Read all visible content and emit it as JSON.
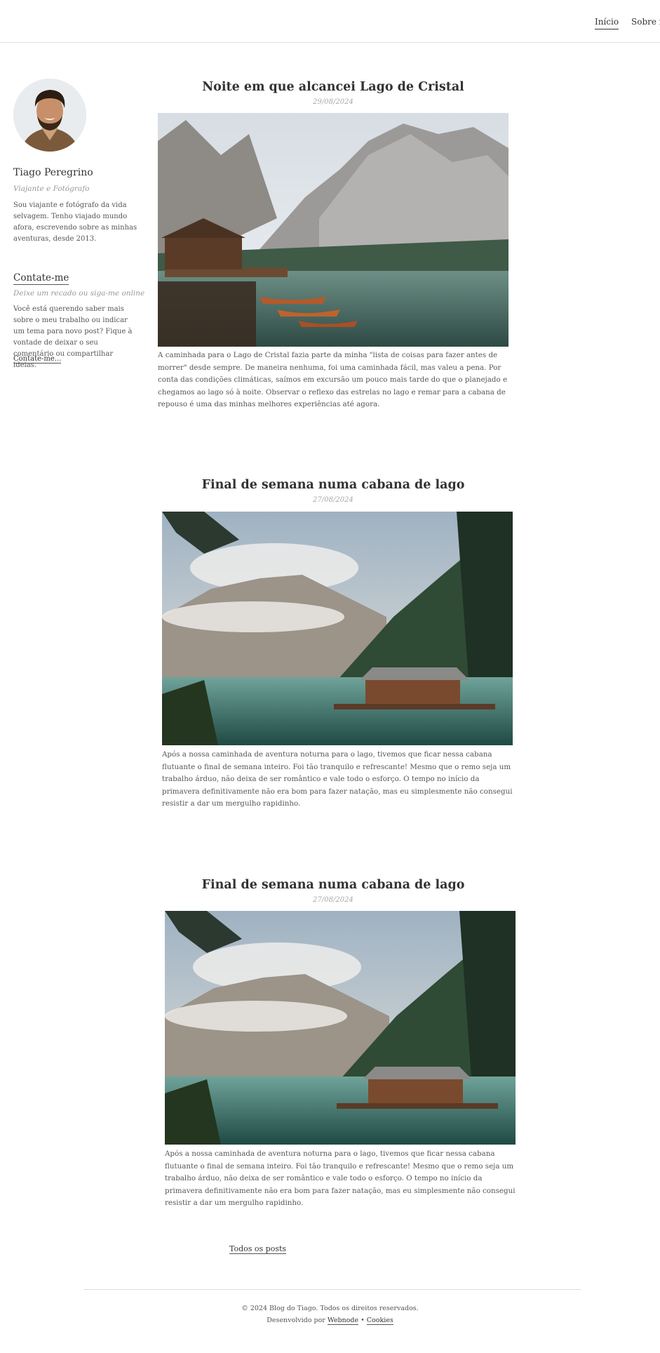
{
  "nav": {
    "items": [
      {
        "label": "Início",
        "active": true
      },
      {
        "label": "Sobre m"
      }
    ]
  },
  "sidebar": {
    "name": "Tiago Peregrino",
    "role": "Viajante e Fotógrafo",
    "bio": "Sou viajante e fotógrafo da vida selvagem. Tenho viajado mundo afora, escrevendo sobre as minhas aventuras, desde 2013.",
    "contact_title": "Contate-me",
    "contact_subtitle": "Deixe um recado ou siga-me online",
    "contact_text": "Você está querendo saber mais sobre o meu trabalho ou indicar um tema para novo post? Fique à vontade de deixar o seu comentário ou compartilhar ideias.",
    "contact_link": "Contate-me..."
  },
  "posts": [
    {
      "title": "Noite em que alcancei Lago de Cristal",
      "date": "29/08/2024",
      "image": "lake-boats-dock-photo",
      "text": "A caminhada para o Lago de Cristal fazia parte da minha \"lista de coisas para fazer antes de morrer\" desde sempre. De maneira nenhuma, foi uma caminhada fácil, mas valeu a pena. Por conta das condições climáticas, saímos em excursão um pouco mais tarde do que o planejado e chegamos ao lago só à noite. Observar o reflexo das estrelas no lago e remar para a cabana de repouso é uma das minhas melhores experiências até agora."
    },
    {
      "title": "Final de semana numa cabana de lago",
      "date": "27/08/2024",
      "image": "lake-cabin-photo",
      "text": "Após a nossa caminhada de aventura noturna para o lago, tivemos que ficar nessa cabana flutuante o final de semana inteiro. Foi tão tranquilo e refrescante! Mesmo que o remo seja um trabalho árduo, não deixa de ser romântico e vale todo o esforço. O tempo no início da primavera definitivamente não era bom para fazer natação, mas eu simplesmente não consegui resistir a dar um mergulho rapidinho."
    },
    {
      "title": "Final de semana numa cabana de lago",
      "date": "27/08/2024",
      "image": "lake-cabin-photo",
      "text": "Após a nossa caminhada de aventura noturna para o lago, tivemos que ficar nessa cabana flutuante o final de semana inteiro. Foi tão tranquilo e refrescante! Mesmo que o remo seja um trabalho árduo, não deixa de ser romântico e vale todo o esforço. O tempo no início da primavera definitivamente não era bom para fazer natação, mas eu simplesmente não consegui resistir a dar um mergulho rapidinho."
    }
  ],
  "all_posts_link": "Todos os posts",
  "footer": {
    "copyright": "© 2024 Blog do Tiago. Todos os direitos reservados.",
    "developed_by": "Desenvolvido por",
    "webnode": "Webnode",
    "separator": "•",
    "cookies": "Cookies"
  },
  "colors": {
    "text": "#444444",
    "muted": "#999999",
    "divider": "#e2e2e2"
  }
}
